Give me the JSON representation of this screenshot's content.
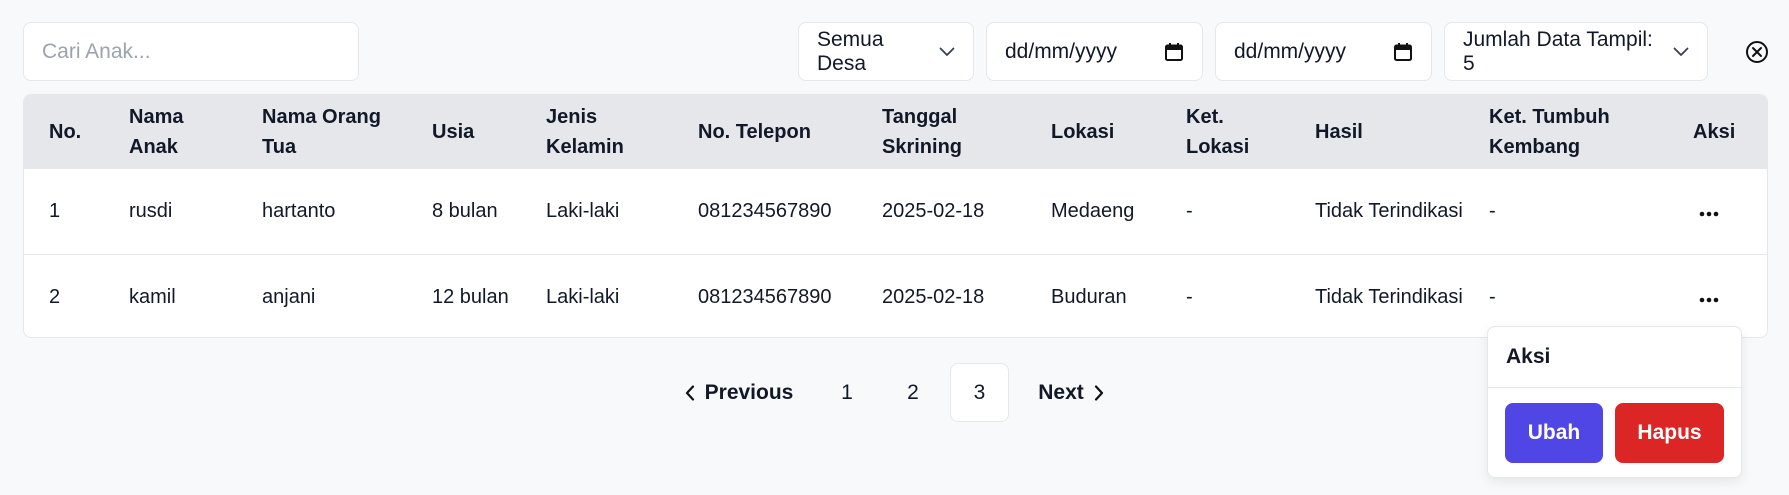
{
  "filters": {
    "search_placeholder": "Cari Anak...",
    "village_select": "Semua Desa",
    "date_from_placeholder": "dd/mm/yyyy",
    "date_to_placeholder": "dd/mm/yyyy",
    "page_size_select": "Jumlah Data Tampil: 5"
  },
  "table": {
    "headers": {
      "no": "No.",
      "nama_anak": "Nama Anak",
      "nama_ortu": "Nama Orang Tua",
      "usia": "Usia",
      "jenis_kelamin": "Jenis Kelamin",
      "telepon": "No. Telepon",
      "tanggal": "Tanggal Skrining",
      "lokasi": "Lokasi",
      "ket_lokasi": "Ket. Lokasi",
      "hasil": "Hasil",
      "ket_tumbuh": "Ket. Tumbuh Kembang",
      "aksi": "Aksi"
    },
    "rows": [
      {
        "no": "1",
        "nama_anak": "rusdi",
        "nama_ortu": "hartanto",
        "usia": "8 bulan",
        "jenis_kelamin": "Laki-laki",
        "telepon": "081234567890",
        "tanggal": "2025-02-18",
        "lokasi": "Medaeng",
        "ket_lokasi": "-",
        "hasil": "Tidak Terindikasi",
        "ket_tumbuh": "-"
      },
      {
        "no": "2",
        "nama_anak": "kamil",
        "nama_ortu": "anjani",
        "usia": "12 bulan",
        "jenis_kelamin": "Laki-laki",
        "telepon": "081234567890",
        "tanggal": "2025-02-18",
        "lokasi": "Buduran",
        "ket_lokasi": "-",
        "hasil": "Tidak Terindikasi",
        "ket_tumbuh": "-"
      }
    ]
  },
  "pagination": {
    "previous": "Previous",
    "next": "Next",
    "pages": [
      "1",
      "2",
      "3"
    ],
    "active_page": "3"
  },
  "action_menu": {
    "title": "Aksi",
    "edit_label": "Ubah",
    "delete_label": "Hapus"
  },
  "colors": {
    "edit_button": "#4f46e5",
    "delete_button": "#dc2626",
    "header_bg": "#e5e7eb",
    "page_bg": "#f8f9fb"
  }
}
